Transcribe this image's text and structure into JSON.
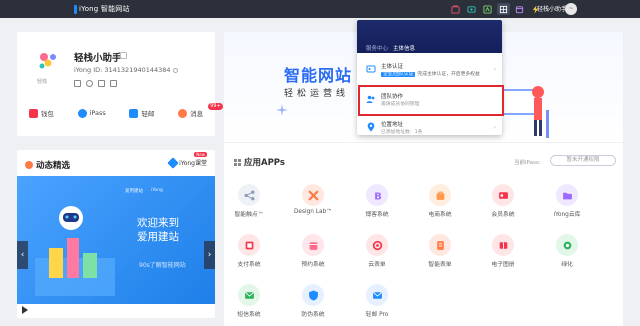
{
  "topbar": {
    "logo_text": "iYong 智能网站",
    "user_name": "轻栈小助手",
    "avatar_text": "~"
  },
  "profile": {
    "name": "轻栈小助手",
    "id_label": "iYong ID: 3141321940144384",
    "bot_caption": "轻栈"
  },
  "quick_menu": [
    {
      "label": "钱包",
      "color": "#f5334a"
    },
    {
      "label": "iPass",
      "color": "#1e8bff"
    },
    {
      "label": "轻邮",
      "color": "#1e8bff"
    },
    {
      "label": "消息",
      "color": "#ff7a45",
      "badge": "99+"
    }
  ],
  "promo": {
    "title": "动态精选",
    "tag_label": "iYong课堂",
    "tag_new": "New",
    "banner_line1": "欢迎来到",
    "banner_line2": "爱用建站",
    "banner_sub": "90s了解智能网站",
    "banner_logo1": "爱用建站",
    "banner_logo2": "iYong"
  },
  "hero": {
    "title": "智能网站",
    "subtitle": "轻松运营线"
  },
  "apps_section": {
    "title": "应用APPs",
    "ipass_label": "当前iPass:",
    "ipass_button": "暂未开通权限"
  },
  "apps": [
    {
      "label": "智能触点™",
      "color": "#eef1f6",
      "fg": "#8c9bb5"
    },
    {
      "label": "Design Lab™",
      "color": "#ffe8e0",
      "fg": "#ff7a45"
    },
    {
      "label": "博客系统",
      "color": "#f0e8ff",
      "fg": "#9b6bff"
    },
    {
      "label": "电商系统",
      "color": "#ffeede",
      "fg": "#ff9a4a"
    },
    {
      "label": "会员系统",
      "color": "#ffe6e6",
      "fg": "#f5334a"
    },
    {
      "label": "iYong云库",
      "color": "#f0e8ff",
      "fg": "#9b6bff"
    },
    {
      "label": "支付系统",
      "color": "#ffe6e6",
      "fg": "#f5334a"
    },
    {
      "label": "预约系统",
      "color": "#ffe6ea",
      "fg": "#ff6b8a"
    },
    {
      "label": "云表单",
      "color": "#ffe6e6",
      "fg": "#f5334a"
    },
    {
      "label": "智能表单",
      "color": "#ffe8e0",
      "fg": "#ff7a45"
    },
    {
      "label": "电子图册",
      "color": "#ffe6e6",
      "fg": "#f5334a"
    },
    {
      "label": "绿化",
      "color": "#e2f7e7",
      "fg": "#2db35d"
    },
    {
      "label": "短信系统",
      "color": "#e2f7e7",
      "fg": "#2db35d"
    },
    {
      "label": "防伪系统",
      "color": "#e6f0ff",
      "fg": "#1e8bff"
    },
    {
      "label": "轻邮 Pro",
      "color": "#e6f0ff",
      "fg": "#1e8bff"
    }
  ],
  "dropdown": {
    "head_label": "服务中心",
    "head_active": "主体信息",
    "items": [
      {
        "title": "主体认证",
        "chip": "企业/团队认证",
        "sub": "完成主体认证，开启更多权益"
      },
      {
        "title": "团队协作",
        "chip": "",
        "sub": "邀请成员协同管理"
      },
      {
        "title": "位置地址",
        "chip": "",
        "sub": "已添加地址数：1条"
      }
    ]
  }
}
